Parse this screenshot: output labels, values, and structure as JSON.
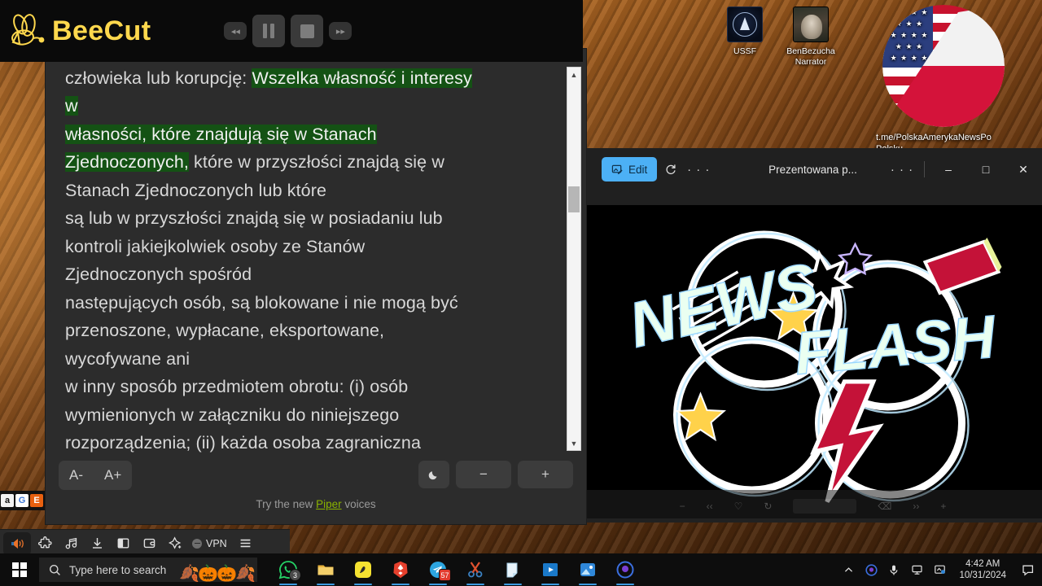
{
  "beecut": {
    "app_name": "BeeCut",
    "logo_icon": "bee-icon",
    "controls": [
      {
        "name": "rewind-button",
        "icon": "rewind-icon",
        "glyph": "◂◂"
      },
      {
        "name": "pause-button",
        "icon": "pause-icon",
        "glyph": "II"
      },
      {
        "name": "stop-button",
        "icon": "stop-icon",
        "glyph": "■"
      },
      {
        "name": "forward-button",
        "icon": "fast-forward-icon",
        "glyph": "▸▸"
      }
    ]
  },
  "reader": {
    "text_before": "zaangażowanych w poważne naruszenia praw\nczłowieka lub korupcję: ",
    "highlight_1": "Wszelka własność i interesy\nw",
    "highlight_2": "własności, które znajdują się w Stanach\nZjednoczonych,",
    "text_after": " które w przyszłości znajdą się w\nStanach Zjednoczonych lub które\nsą lub w przyszłości znajdą się w posiadaniu lub\nkontroli jakiejkolwiek osoby ze Stanów\nZjednoczonych spośród\nnastępujących osób, są blokowane i nie mogą być\nprzenoszone, wypłacane, eksportowane,\nwycofywane ani\nw inny sposób przedmiotem obrotu: (i) osób\nwymienionych w załączniku do niniejszego\nrozporządzenia; (ii) każda osoba zagraniczna",
    "highlight_color": "#145214",
    "font_decrease_label": "A-",
    "font_increase_label": "A+",
    "dark_mode_icon": "moon-icon",
    "speed_down_label": "−",
    "speed_up_label": "+",
    "promo_prefix": "Try the new ",
    "promo_link": "Piper",
    "promo_suffix": " voices",
    "promo_link_color": "#8ab300",
    "scroll_up_icon": "scroll-up-arrow-icon",
    "scroll_down_icon": "scroll-down-arrow-icon"
  },
  "photos": {
    "edit_label": "Edit",
    "edit_icon": "edit-image-icon",
    "rotate_icon": "rotate-icon",
    "more_left_label": "· · ·",
    "title": "Prezentowana p...",
    "more_right_label": "· · ·",
    "minimize_label": "–",
    "maximize_label": "□",
    "close_label": "✕",
    "image_alt": "NEWS FLASH",
    "image_word_1": "NEWS",
    "image_word_2": "FLASH",
    "accent_blue": "#4cb0f5"
  },
  "desktop": {
    "icons": [
      {
        "name": "desktop-icon-ussf",
        "label": "USSF",
        "icon": "space-force-icon"
      },
      {
        "name": "desktop-icon-benbezucha",
        "label": "BenBezucha\nNarrator",
        "icon": "narrator-avatar-icon"
      },
      {
        "name": "desktop-icon-telegram-channel",
        "label": "t.me/PolskaAmerykaNewsPo Polsku",
        "icon": "us-poland-flag-icon"
      }
    ]
  },
  "brave_toolbar": {
    "items": [
      {
        "name": "speaker-button",
        "icon": "speaker-icon"
      },
      {
        "name": "extensions-button",
        "icon": "puzzle-piece-icon"
      },
      {
        "name": "music-button",
        "icon": "music-note-icon"
      },
      {
        "name": "downloads-button",
        "icon": "download-icon"
      },
      {
        "name": "sidebar-button",
        "icon": "sidebar-panel-icon"
      },
      {
        "name": "wallet-button",
        "icon": "wallet-icon"
      },
      {
        "name": "leo-ai-button",
        "icon": "sparkle-icon"
      },
      {
        "name": "vpn-button",
        "icon": "vpn-icon",
        "label": "VPN"
      },
      {
        "name": "menu-button",
        "icon": "hamburger-menu-icon"
      }
    ],
    "favicons": [
      "a",
      "G",
      "E"
    ]
  },
  "taskbar": {
    "start_icon": "windows-start-icon",
    "search_icon": "search-icon",
    "search_placeholder": "Type here to search",
    "search_value": "",
    "decoration_icon": "halloween-pumpkins-icon",
    "apps": [
      {
        "name": "taskbar-whatsapp",
        "icon": "whatsapp-icon",
        "badge": "3"
      },
      {
        "name": "taskbar-file-explorer",
        "icon": "folder-icon",
        "badge": ""
      },
      {
        "name": "taskbar-app-yellow",
        "icon": "yellow-app-icon",
        "badge": ""
      },
      {
        "name": "taskbar-brave",
        "icon": "brave-lion-icon",
        "badge": ""
      },
      {
        "name": "taskbar-telegram",
        "icon": "telegram-icon",
        "badge": "57"
      },
      {
        "name": "taskbar-snipping-tool",
        "icon": "scissors-icon",
        "badge": ""
      },
      {
        "name": "taskbar-sticky-notes",
        "icon": "sticky-notes-icon",
        "badge": ""
      },
      {
        "name": "taskbar-movies-tv",
        "icon": "movies-tv-icon",
        "badge": ""
      },
      {
        "name": "taskbar-photos",
        "icon": "photos-icon",
        "badge": ""
      },
      {
        "name": "taskbar-camo",
        "icon": "camo-studio-icon",
        "badge": ""
      }
    ],
    "tray": [
      {
        "name": "tray-show-hidden",
        "icon": "chevron-up-icon"
      },
      {
        "name": "tray-camo",
        "icon": "camo-tray-icon"
      },
      {
        "name": "tray-microphone",
        "icon": "microphone-icon"
      },
      {
        "name": "tray-network",
        "icon": "network-icon"
      },
      {
        "name": "tray-display",
        "icon": "display-icon"
      }
    ],
    "time": "4:42 AM",
    "date": "10/31/2024",
    "notification_icon": "action-center-icon"
  }
}
